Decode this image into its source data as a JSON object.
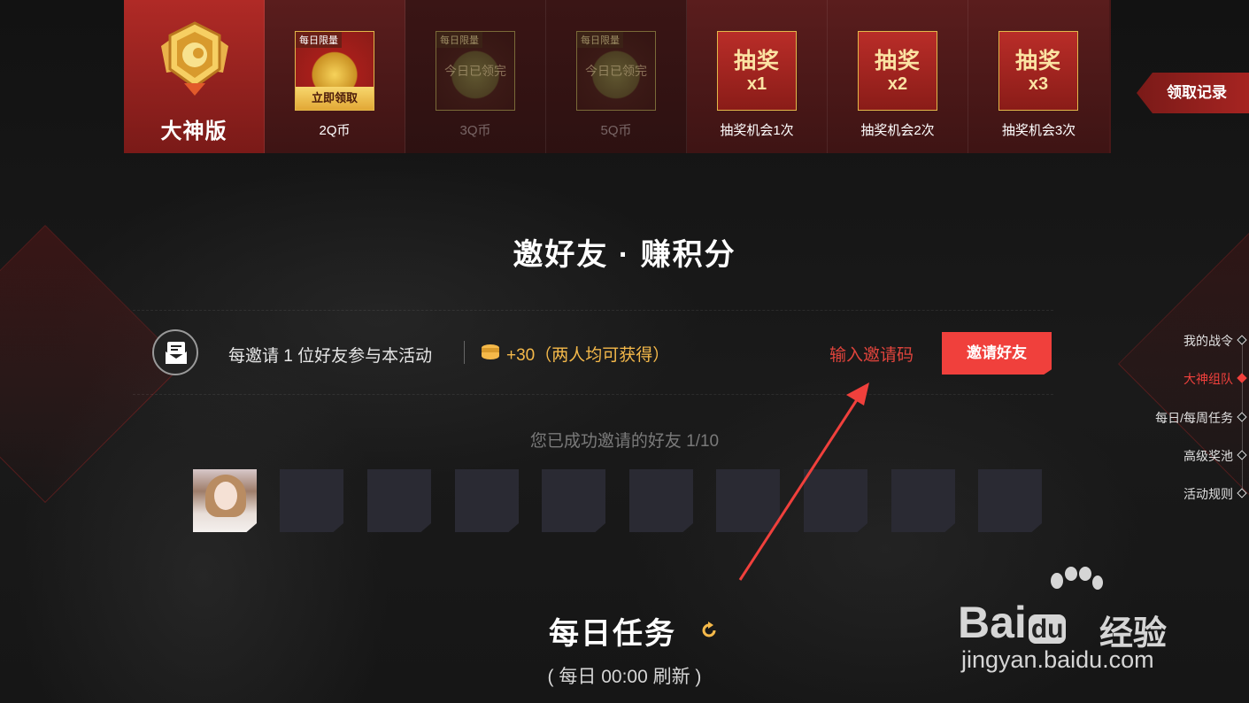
{
  "rewards": {
    "badge_title": "大神版",
    "cells": [
      {
        "tag": "每日限量",
        "action": "立即领取",
        "label": "2Q币"
      },
      {
        "tag": "每日限量",
        "status": "今日已领完",
        "label": "3Q币"
      },
      {
        "tag": "每日限量",
        "status": "今日已领完",
        "label": "5Q币"
      },
      {
        "word": "抽奖",
        "multiplier": "x1",
        "label": "抽奖机会1次"
      },
      {
        "word": "抽奖",
        "multiplier": "x2",
        "label": "抽奖机会2次"
      },
      {
        "word": "抽奖",
        "multiplier": "x3",
        "label": "抽奖机会3次"
      }
    ],
    "record_label": "领取记录"
  },
  "invite": {
    "section_title": "邀好友 · 赚积分",
    "description": "每邀请 1 位好友参与本活动",
    "bonus": "+30（两人均可获得）",
    "enter_code": "输入邀请码",
    "invite_button": "邀请好友",
    "progress_text": "您已成功邀请的好友 1/10",
    "invited": 1,
    "total_slots": 10
  },
  "side_nav": {
    "items": [
      "我的战令",
      "大神组队",
      "每日/每周任务",
      "高级奖池",
      "活动规则"
    ],
    "active_index": 1
  },
  "daily": {
    "title": "每日任务",
    "note": "( 每日 00:00 刷新 )"
  },
  "watermark": {
    "logo": "Bai",
    "logo_du": "du",
    "brand": "经验",
    "url": "jingyan.baidu.com"
  },
  "colors": {
    "accent_red": "#f0403c",
    "gold": "#f5b94a",
    "strip_bg": "#4a1818"
  }
}
